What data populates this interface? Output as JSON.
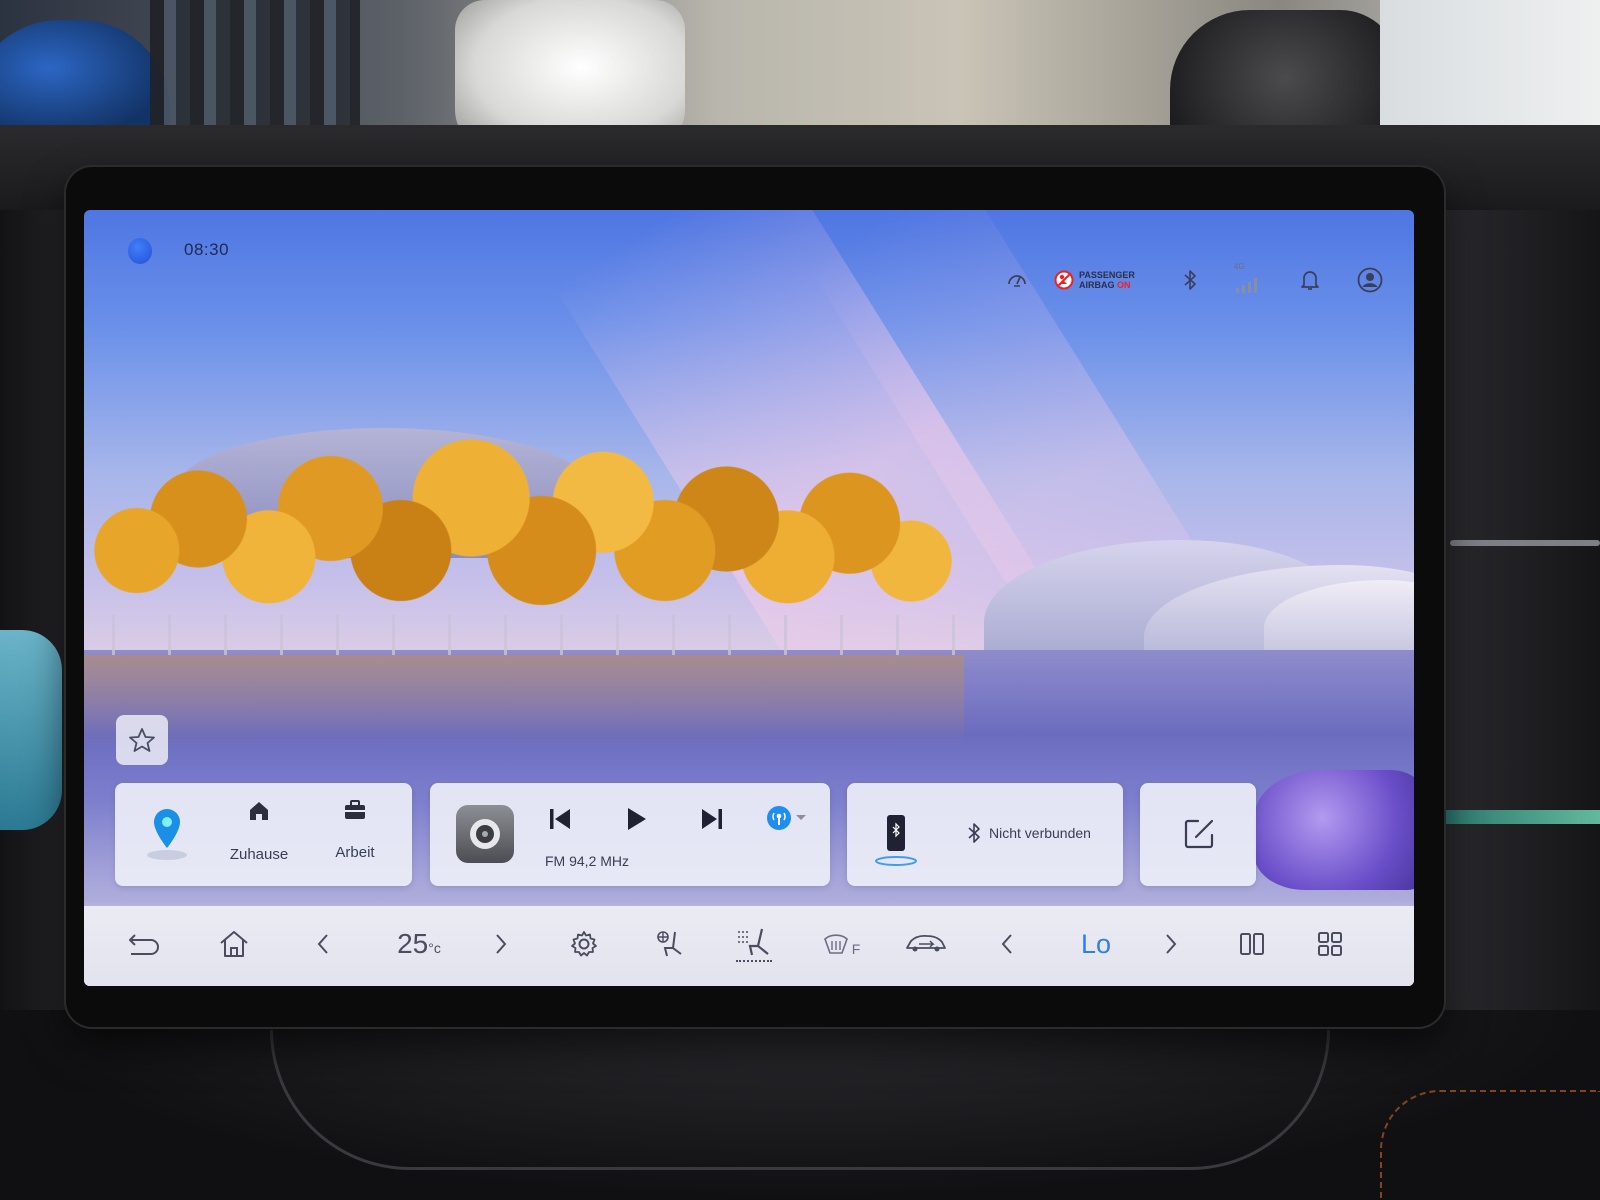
{
  "status_bar": {
    "time": "08:30",
    "airbag_line1": "PASSENGER",
    "airbag_line2": "AIRBAG",
    "airbag_state": "ON",
    "network": "4G",
    "icons": [
      "assistant-icon",
      "speed-volume-icon",
      "airbag-off-icon",
      "bluetooth-icon",
      "signal-icon",
      "bell-icon",
      "user-icon"
    ]
  },
  "navigation_card": {
    "home_label": "Zuhause",
    "work_label": "Arbeit"
  },
  "media_card": {
    "station": "FM 94,2 MHz"
  },
  "phone_card": {
    "bluetooth_status": "Nicht verbunden"
  },
  "control_bar": {
    "temperature_value": "25",
    "temperature_unit": "°c",
    "fan_level": "Lo",
    "defrost_label": "F"
  },
  "colors": {
    "accent": "#2f7fe8",
    "airbag_on": "#e22222",
    "card_bg": "#eceef7"
  }
}
